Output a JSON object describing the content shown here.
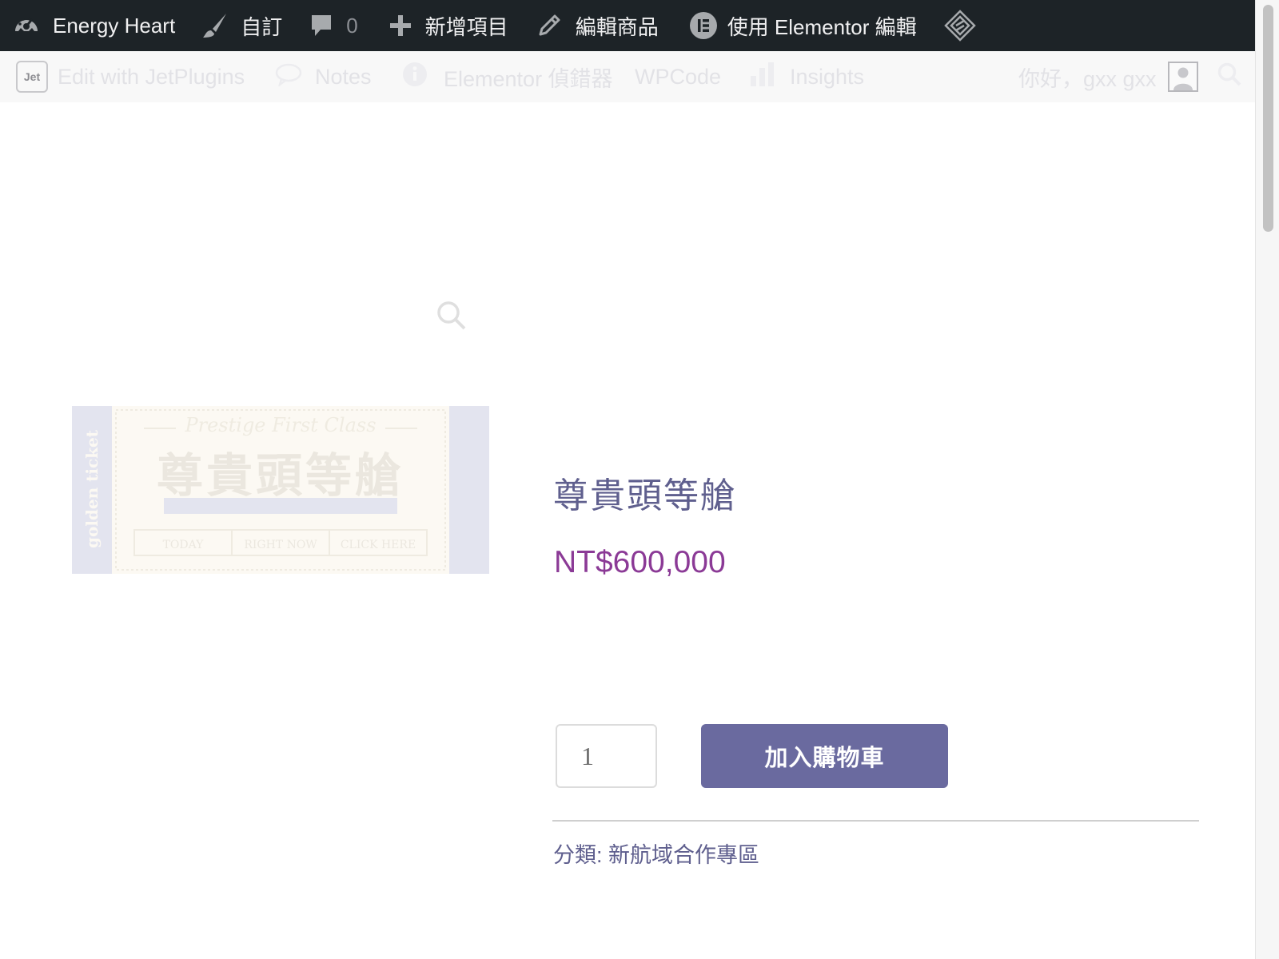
{
  "adminbar": {
    "site_name": "Energy Heart",
    "customize": "自訂",
    "comments_count": "0",
    "new_item": "新增項目",
    "edit_product": "編輯商品",
    "elementor_edit": "使用 Elementor 編輯"
  },
  "adminbar2": {
    "jet_logo": "Jet",
    "edit_jetplugins": "Edit with JetPlugins",
    "notes": "Notes",
    "elementor_debugger": "Elementor 偵錯器",
    "wpcode": "WPCode",
    "insights": "Insights",
    "greeting": "你好，gxx gxx"
  },
  "ticket": {
    "top_script": "Prestige First Class",
    "main_text": "尊貴頭等艙",
    "side_left": "golden ticket",
    "cells": [
      "TODAY",
      "RIGHT NOW",
      "CLICK HERE"
    ]
  },
  "product": {
    "title": "尊貴頭等艙",
    "price": "NT$600,000",
    "quantity": "1",
    "add_to_cart": "加入購物車",
    "category_label": "分類:",
    "category_value": "新航域合作專區"
  },
  "colors": {
    "adminbar_bg": "#1d2327",
    "title": "#5f5f8e",
    "price": "#8b3a96",
    "button": "#6a6a9f"
  },
  "icons": [
    "dashboard-icon",
    "brush-icon",
    "comment-icon",
    "plus-icon",
    "pencil-icon",
    "elementor-icon",
    "diamond-icon",
    "jet-icon",
    "chat-icon",
    "info-icon",
    "bar-chart-icon",
    "avatar-icon",
    "search-icon",
    "zoom-icon"
  ]
}
